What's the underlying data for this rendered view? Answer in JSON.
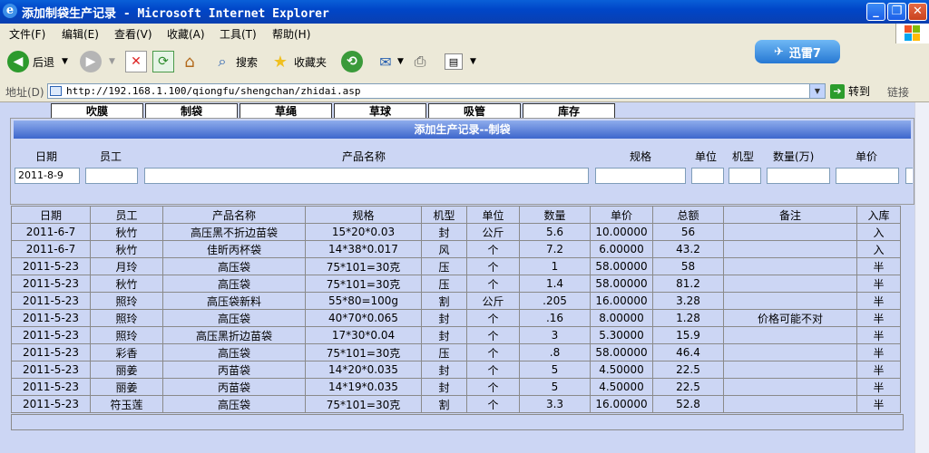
{
  "window": {
    "title": "添加制袋生产记录 - Microsoft Internet Explorer"
  },
  "menu": [
    "文件(F)",
    "编辑(E)",
    "查看(V)",
    "收藏(A)",
    "工具(T)",
    "帮助(H)"
  ],
  "toolbar": {
    "back": "后退",
    "search": "搜索",
    "favorites": "收藏夹",
    "thunder": "迅雷7"
  },
  "address": {
    "label": "地址(D)",
    "url": "http://192.168.1.100/qiongfu/shengchan/zhidai.asp",
    "go": "转到",
    "links": "链接"
  },
  "tabs": [
    "吹膜",
    "制袋",
    "草绳",
    "草球",
    "吸管",
    "库存"
  ],
  "form": {
    "title": "添加生产记录--制袋",
    "labels": [
      "日期",
      "员工",
      "产品名称",
      "规格",
      "单位",
      "机型",
      "数量(万)",
      "单价"
    ],
    "date_value": "2011-8-9"
  },
  "table": {
    "headers": [
      "日期",
      "员工",
      "产品名称",
      "规格",
      "机型",
      "单位",
      "数量",
      "单价",
      "总额",
      "备注",
      "入库"
    ],
    "rows": [
      [
        "2011-6-7",
        "秋竹",
        "高压黑不折边苗袋",
        "15*20*0.03",
        "封",
        "公斤",
        "5.6",
        "10.00000",
        "56",
        "",
        "入"
      ],
      [
        "2011-6-7",
        "秋竹",
        "佳昕丙杯袋",
        "14*38*0.017",
        "风",
        "个",
        "7.2",
        "6.00000",
        "43.2",
        "",
        "入"
      ],
      [
        "2011-5-23",
        "月玲",
        "高压袋",
        "75*101=30克",
        "压",
        "个",
        "1",
        "58.00000",
        "58",
        "",
        "半"
      ],
      [
        "2011-5-23",
        "秋竹",
        "高压袋",
        "75*101=30克",
        "压",
        "个",
        "1.4",
        "58.00000",
        "81.2",
        "",
        "半"
      ],
      [
        "2011-5-23",
        "照玲",
        "高压袋新料",
        "55*80=100g",
        "割",
        "公斤",
        ".205",
        "16.00000",
        "3.28",
        "",
        "半"
      ],
      [
        "2011-5-23",
        "照玲",
        "高压袋",
        "40*70*0.065",
        "封",
        "个",
        ".16",
        "8.00000",
        "1.28",
        "价格可能不对",
        "半"
      ],
      [
        "2011-5-23",
        "照玲",
        "高压黑折边苗袋",
        "17*30*0.04",
        "封",
        "个",
        "3",
        "5.30000",
        "15.9",
        "",
        "半"
      ],
      [
        "2011-5-23",
        "彩香",
        "高压袋",
        "75*101=30克",
        "压",
        "个",
        ".8",
        "58.00000",
        "46.4",
        "",
        "半"
      ],
      [
        "2011-5-23",
        "丽姜",
        "丙苗袋",
        "14*20*0.035",
        "封",
        "个",
        "5",
        "4.50000",
        "22.5",
        "",
        "半"
      ],
      [
        "2011-5-23",
        "丽姜",
        "丙苗袋",
        "14*19*0.035",
        "封",
        "个",
        "5",
        "4.50000",
        "22.5",
        "",
        "半"
      ],
      [
        "2011-5-23",
        "符玉莲",
        "高压袋",
        "75*101=30克",
        "割",
        "个",
        "3.3",
        "16.00000",
        "52.8",
        "",
        "半"
      ]
    ]
  }
}
